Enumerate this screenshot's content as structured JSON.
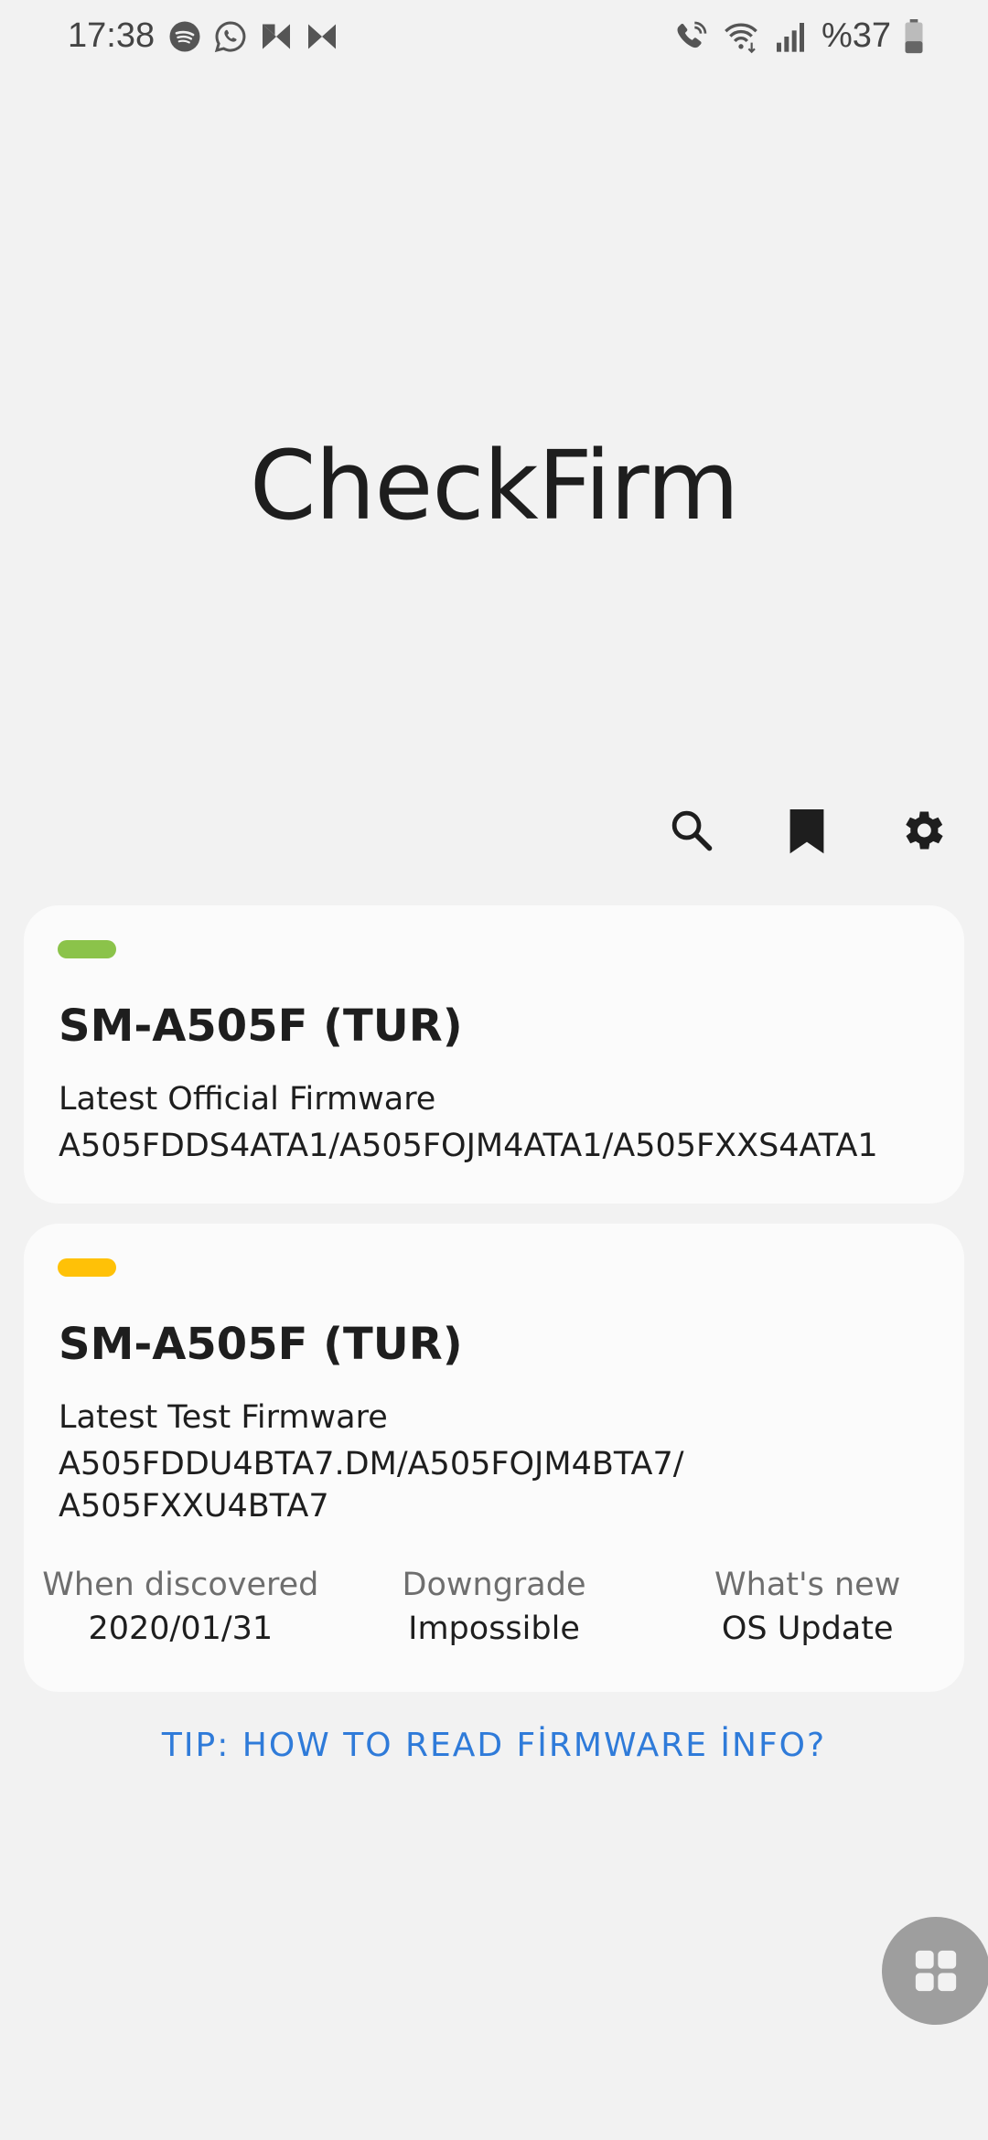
{
  "status_bar": {
    "time": "17:38",
    "left_icons": [
      "spotify-icon",
      "whatsapp-icon",
      "bowtie-icon",
      "bowtie-icon"
    ],
    "right_icons": [
      "wifi-call-icon",
      "wifi-icon",
      "signal-icon"
    ],
    "battery_text": "%37"
  },
  "app": {
    "title": "CheckFirm"
  },
  "actions": {
    "search_icon": "search-icon",
    "bookmark_icon": "bookmark-icon",
    "settings_icon": "gear-icon"
  },
  "cards": {
    "official": {
      "indicator_color": "#8bc34a",
      "model": "SM-A505F (TUR)",
      "label": "Latest Official Firmware",
      "firmware": "A505FDDS4ATA1/A505FOJM4ATA1/A505FXXS4ATA1"
    },
    "test": {
      "indicator_color": "#ffc107",
      "model": "SM-A505F (TUR)",
      "label": "Latest Test Firmware",
      "firmware": "A505FDDU4BTA7.DM/A505FOJM4BTA7/ A505FXXU4BTA7",
      "details": {
        "discovered_label": "When discovered",
        "discovered_value": "2020/01/31",
        "downgrade_label": "Downgrade",
        "downgrade_value": "Impossible",
        "whats_new_label": "What's new",
        "whats_new_value": "OS Update"
      }
    }
  },
  "tip": {
    "text": "TIP: HOW TO READ FİRMWARE İNFO?"
  },
  "fab": {
    "icon": "grid-icon",
    "color": "#9e9e9e"
  },
  "colors": {
    "background": "#f2f2f2",
    "card": "#fbfbfb",
    "link": "#2f7bd9"
  }
}
